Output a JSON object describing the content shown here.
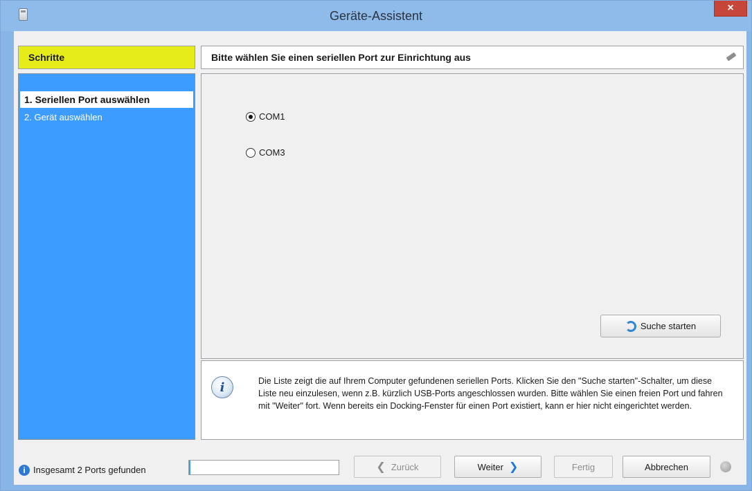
{
  "window": {
    "title": "Geräte-Assistent",
    "close_symbol": "×"
  },
  "steps": {
    "header": "Schritte",
    "items": [
      {
        "label": "1. Seriellen Port auswählen",
        "active": true
      },
      {
        "label": "2. Gerät auswählen",
        "active": false
      }
    ]
  },
  "content": {
    "header": "Bitte wählen Sie einen seriellen Port zur Einrichtung aus",
    "ports": [
      {
        "label": "COM1",
        "selected": true
      },
      {
        "label": "COM3",
        "selected": false
      }
    ],
    "search_button": "Suche starten",
    "info_text": "Die Liste zeigt die auf Ihrem Computer gefundenen seriellen Ports. Klicken Sie den \"Suche starten\"-Schalter, um diese Liste neu einzulesen, wenn z.B. kürzlich USB-Ports angeschlossen wurden. Bitte wählen Sie einen freien Port und fahren mit \"Weiter\" fort. Wenn bereits ein Docking-Fenster für einen Port existiert, kann er hier nicht eingerichtet werden."
  },
  "footer": {
    "status_text": "Insgesamt 2 Ports gefunden",
    "progress": 0.01,
    "back_label": "Zurück",
    "next_label": "Weiter",
    "finish_label": "Fertig",
    "cancel_label": "Abbrechen"
  },
  "colors": {
    "steps_header_bg": "#e6ec1a",
    "steps_panel_bg": "#3d9cff",
    "titlebar_bg": "#8fbbea",
    "close_bg": "#c7463a"
  },
  "icons": [
    "app-icon",
    "close-icon",
    "pencil-icon",
    "refresh-icon",
    "info-icon",
    "status-info-icon",
    "arrow-left-icon",
    "arrow-right-icon",
    "status-dot-icon"
  ]
}
